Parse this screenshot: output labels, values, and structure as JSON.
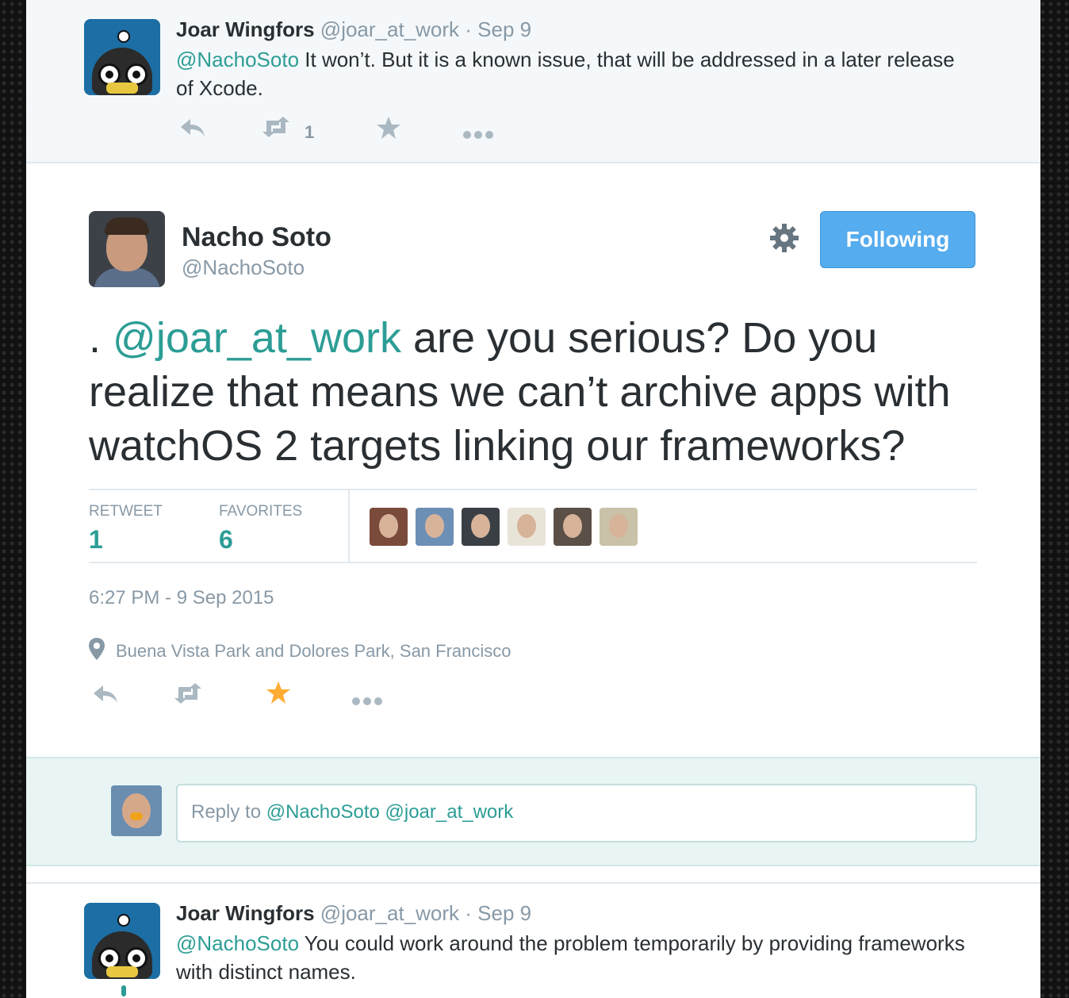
{
  "top_tweet": {
    "name": "Joar Wingfors",
    "handle": "@joar_at_work",
    "date": "· Sep 9",
    "mention": "@NachoSoto",
    "text": " It won’t. But it is a known issue, that will be addressed in a later release of Xcode.",
    "retweet_count": "1"
  },
  "main_tweet": {
    "name": "Nacho Soto",
    "handle": "@NachoSoto",
    "follow_label": "Following",
    "text_prefix": ". ",
    "mention": "@joar_at_work",
    "text": " are you serious? Do you realize that means we can’t archive apps with watchOS 2 targets linking our frameworks?",
    "retweet_label": "RETWEET",
    "retweet_count": "1",
    "favorites_label": "FAVORITES",
    "favorites_count": "6",
    "timestamp": "6:27 PM - 9 Sep 2015",
    "location": "Buena Vista Park and Dolores Park, San Francisco",
    "favorited": true
  },
  "reply_box": {
    "prefix": "Reply to ",
    "mentions": "@NachoSoto @joar_at_work"
  },
  "bottom_tweet": {
    "name": "Joar Wingfors",
    "handle": "@joar_at_work",
    "date": "· Sep 9",
    "mention": "@NachoSoto",
    "text": " You could work around the problem temporarily by providing frameworks with distinct names."
  },
  "colors": {
    "accent": "#2c9d95",
    "follow_button": "#55acee",
    "favorite_star": "#ffac33",
    "muted": "#8899a6"
  },
  "icons": [
    "reply-icon",
    "retweet-icon",
    "favorite-icon",
    "more-icon",
    "gear-icon",
    "location-pin-icon"
  ]
}
